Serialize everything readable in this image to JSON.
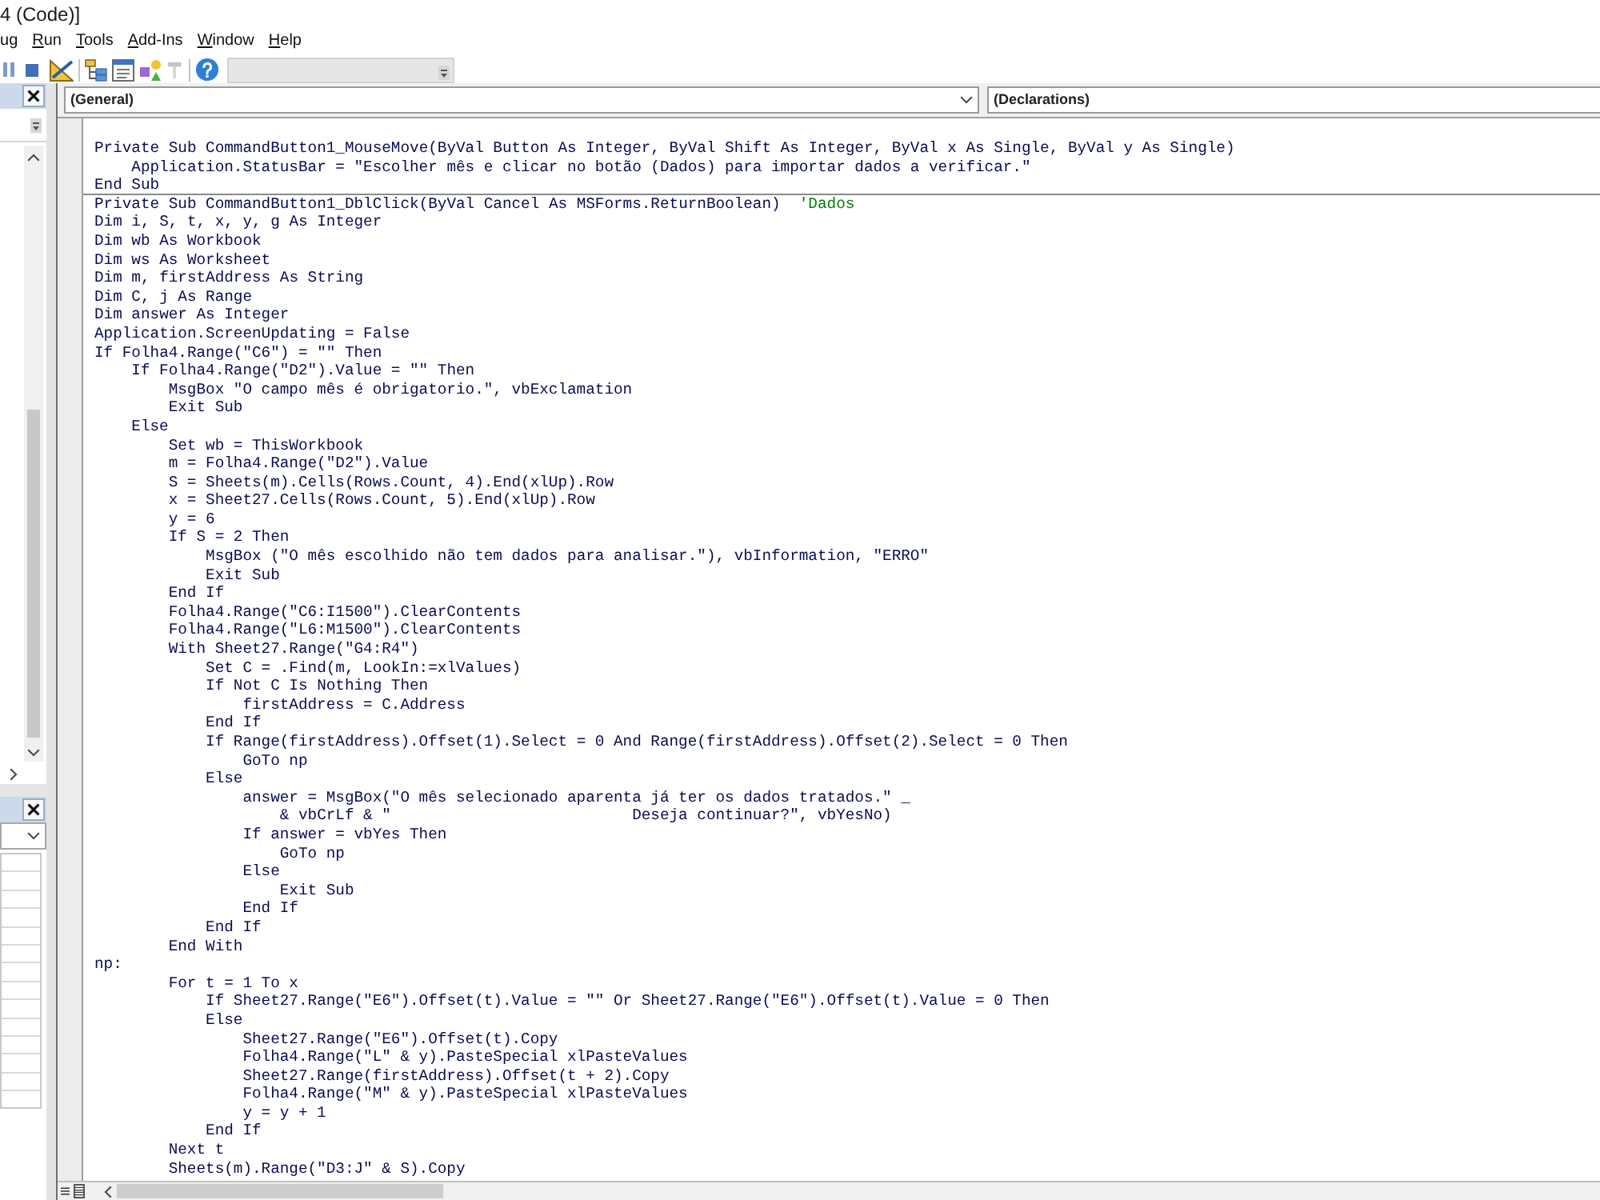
{
  "window": {
    "title": "4 (Code)]"
  },
  "menu": [
    {
      "label": "ug",
      "mnemonic": false
    },
    {
      "label": "Run",
      "mnemonic": true
    },
    {
      "label": "Tools",
      "mnemonic": true
    },
    {
      "label": "Add-Ins",
      "mnemonic": true
    },
    {
      "label": "Window",
      "mnemonic": true
    },
    {
      "label": "Help",
      "mnemonic": true
    }
  ],
  "toolbar": [
    {
      "items": [
        {
          "kind": "pause",
          "disabled": false
        },
        {
          "kind": "stop",
          "disabled": false
        },
        {
          "kind": "design_mode",
          "disabled": false
        }
      ]
    },
    {
      "items": [
        {
          "kind": "project_explorer",
          "disabled": false
        },
        {
          "kind": "properties",
          "disabled": false
        },
        {
          "kind": "object_browser",
          "disabled": false
        },
        {
          "kind": "toolbox",
          "disabled": true
        }
      ]
    },
    {
      "items": [
        {
          "kind": "help",
          "disabled": false
        }
      ]
    }
  ],
  "code_window": {
    "object_box": "(General)",
    "procedure_box": "(Declarations)",
    "procedures": [
      {
        "lines": [
          {
            "code": "Private Sub CommandButton1_MouseMove(ByVal Button As Integer, ByVal Shift As Integer, ByVal x As Single, ByVal y As Single)"
          },
          {
            "code": "    Application.StatusBar = \"Escolher mês e clicar no botão (Dados) para importar dados a verificar.\""
          },
          {
            "code": "End Sub"
          }
        ]
      },
      {
        "lines": [
          {
            "code": "Private Sub CommandButton1_DblClick(ByVal Cancel As MSForms.ReturnBoolean)",
            "comment": "'Dados"
          },
          {
            "code": "Dim i, S, t, x, y, g As Integer"
          },
          {
            "code": "Dim wb As Workbook"
          },
          {
            "code": "Dim ws As Worksheet"
          },
          {
            "code": "Dim m, firstAddress As String"
          },
          {
            "code": "Dim C, j As Range"
          },
          {
            "code": "Dim answer As Integer"
          },
          {
            "code": "Application.ScreenUpdating = False"
          },
          {
            "code": "If Folha4.Range(\"C6\") = \"\" Then"
          },
          {
            "code": "    If Folha4.Range(\"D2\").Value = \"\" Then"
          },
          {
            "code": "        MsgBox \"O campo mês é obrigatorio.\", vbExclamation"
          },
          {
            "code": "        Exit Sub"
          },
          {
            "code": "    Else"
          },
          {
            "code": "        Set wb = ThisWorkbook"
          },
          {
            "code": "        m = Folha4.Range(\"D2\").Value"
          },
          {
            "code": "        S = Sheets(m).Cells(Rows.Count, 4).End(xlUp).Row"
          },
          {
            "code": "        x = Sheet27.Cells(Rows.Count, 5).End(xlUp).Row"
          },
          {
            "code": "        y = 6"
          },
          {
            "code": "        If S = 2 Then"
          },
          {
            "code": "            MsgBox (\"O mês escolhido não tem dados para analisar.\"), vbInformation, \"ERRO\""
          },
          {
            "code": "            Exit Sub"
          },
          {
            "code": "        End If"
          },
          {
            "code": "        Folha4.Range(\"C6:I1500\").ClearContents"
          },
          {
            "code": "        Folha4.Range(\"L6:M1500\").ClearContents"
          },
          {
            "code": "        With Sheet27.Range(\"G4:R4\")"
          },
          {
            "code": "            Set C = .Find(m, LookIn:=xlValues)"
          },
          {
            "code": "            If Not C Is Nothing Then"
          },
          {
            "code": "                firstAddress = C.Address"
          },
          {
            "code": "            End If"
          },
          {
            "code": "            If Range(firstAddress).Offset(1).Select = 0 And Range(firstAddress).Offset(2).Select = 0 Then"
          },
          {
            "code": "                GoTo np"
          },
          {
            "code": "            Else"
          },
          {
            "code": "                answer = MsgBox(\"O mês selecionado aparenta já ter os dados tratados.\" _"
          },
          {
            "code": "                    & vbCrLf & \"                          Deseja continuar?\", vbYesNo)"
          },
          {
            "code": "                If answer = vbYes Then"
          },
          {
            "code": "                    GoTo np"
          },
          {
            "code": "                Else"
          },
          {
            "code": "                    Exit Sub"
          },
          {
            "code": "                End If"
          },
          {
            "code": "            End If"
          },
          {
            "code": "        End With"
          },
          {
            "code": "np:"
          },
          {
            "code": "        For t = 1 To x"
          },
          {
            "code": "            If Sheet27.Range(\"E6\").Offset(t).Value = \"\" Or Sheet27.Range(\"E6\").Offset(t).Value = 0 Then"
          },
          {
            "code": "            Else"
          },
          {
            "code": "                Sheet27.Range(\"E6\").Offset(t).Copy"
          },
          {
            "code": "                Folha4.Range(\"L\" & y).PasteSpecial xlPasteValues"
          },
          {
            "code": "                Sheet27.Range(firstAddress).Offset(t + 2).Copy"
          },
          {
            "code": "                Folha4.Range(\"M\" & y).PasteSpecial xlPasteValues"
          },
          {
            "code": "                y = y + 1"
          },
          {
            "code": "            End If"
          },
          {
            "code": "        Next t"
          },
          {
            "code": "        Sheets(m).Range(\"D3:J\" & S).Copy"
          }
        ]
      }
    ],
    "views": [
      {
        "kind": "procedure",
        "selected": false
      },
      {
        "kind": "module",
        "selected": true
      }
    ]
  }
}
